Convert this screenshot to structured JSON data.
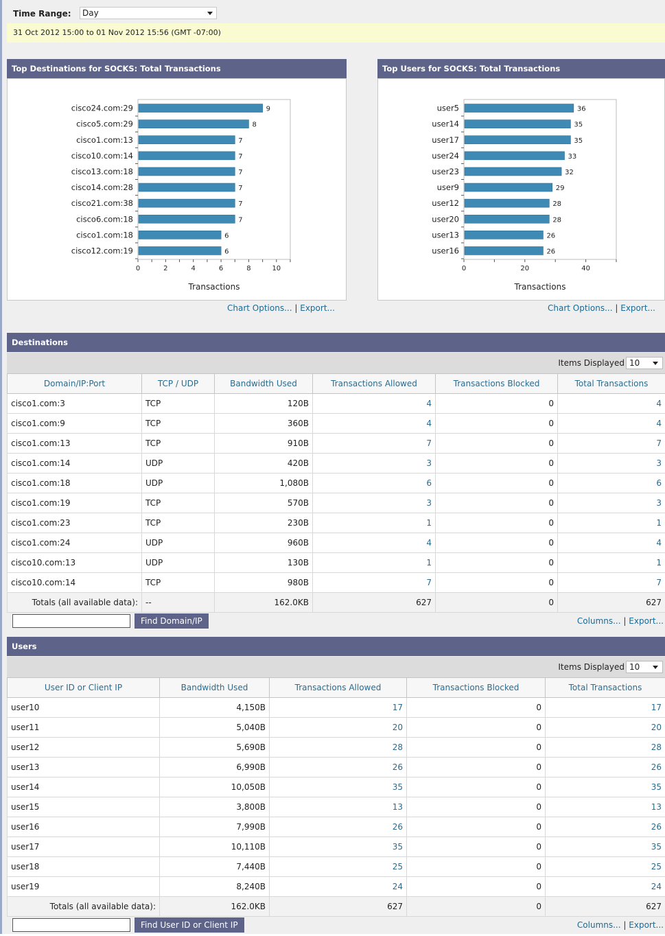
{
  "time_range": {
    "label": "Time Range:",
    "value": "Day"
  },
  "date_range": "31 Oct 2012 15:00 to 01 Nov 2012 15:56 (GMT -07:00)",
  "chart_links": {
    "options": "Chart Options...",
    "sep": "|",
    "export": "Export..."
  },
  "chart_data": [
    {
      "type": "bar",
      "orientation": "horizontal",
      "title": "Top Destinations for SOCKS: Total Transactions",
      "categories": [
        "cisco24.com:29",
        "cisco5.com:29",
        "cisco1.com:13",
        "cisco10.com:14",
        "cisco13.com:18",
        "cisco14.com:28",
        "cisco21.com:38",
        "cisco6.com:18",
        "cisco1.com:18",
        "cisco12.com:19"
      ],
      "values": [
        9,
        8,
        7,
        7,
        7,
        7,
        7,
        7,
        6,
        6
      ],
      "xlabel": "Transactions",
      "xlim": [
        0,
        11
      ],
      "xticks": [
        0,
        2,
        4,
        6,
        8,
        10
      ],
      "bar_color": "#3f8ab5",
      "data_labels": true,
      "grid": false
    },
    {
      "type": "bar",
      "orientation": "horizontal",
      "title": "Top Users for SOCKS: Total Transactions",
      "categories": [
        "user5",
        "user14",
        "user17",
        "user24",
        "user23",
        "user9",
        "user12",
        "user20",
        "user13",
        "user16"
      ],
      "values": [
        36,
        35,
        35,
        33,
        32,
        29,
        28,
        28,
        26,
        26
      ],
      "xlabel": "Transactions",
      "xlim": [
        0,
        50
      ],
      "xticks": [
        0,
        20,
        40
      ],
      "bar_color": "#3f8ab5",
      "data_labels": true,
      "grid": false
    }
  ],
  "destinations": {
    "title": "Destinations",
    "items_label": "Items Displayed",
    "items_value": "10",
    "columns": [
      "Domain/IP:Port",
      "TCP / UDP",
      "Bandwidth Used",
      "Transactions Allowed",
      "Transactions Blocked",
      "Total Transactions"
    ],
    "rows": [
      [
        "cisco1.com:3",
        "TCP",
        "120B",
        "4",
        "0",
        "4"
      ],
      [
        "cisco1.com:9",
        "TCP",
        "360B",
        "4",
        "0",
        "4"
      ],
      [
        "cisco1.com:13",
        "TCP",
        "910B",
        "7",
        "0",
        "7"
      ],
      [
        "cisco1.com:14",
        "UDP",
        "420B",
        "3",
        "0",
        "3"
      ],
      [
        "cisco1.com:18",
        "UDP",
        "1,080B",
        "6",
        "0",
        "6"
      ],
      [
        "cisco1.com:19",
        "TCP",
        "570B",
        "3",
        "0",
        "3"
      ],
      [
        "cisco1.com:23",
        "TCP",
        "230B",
        "1",
        "0",
        "1"
      ],
      [
        "cisco1.com:24",
        "UDP",
        "960B",
        "4",
        "0",
        "4"
      ],
      [
        "cisco10.com:13",
        "UDP",
        "130B",
        "1",
        "0",
        "1"
      ],
      [
        "cisco10.com:14",
        "TCP",
        "980B",
        "7",
        "0",
        "7"
      ]
    ],
    "totals": [
      "Totals (all available data):",
      "--",
      "162.0KB",
      "627",
      "0",
      "627"
    ],
    "find_button": "Find Domain/IP",
    "links": {
      "columns": "Columns...",
      "sep": "|",
      "export": "Export..."
    }
  },
  "users": {
    "title": "Users",
    "items_label": "Items Displayed",
    "items_value": "10",
    "columns": [
      "User ID or Client IP",
      "Bandwidth Used",
      "Transactions Allowed",
      "Transactions Blocked",
      "Total Transactions"
    ],
    "rows": [
      [
        "user10",
        "4,150B",
        "17",
        "0",
        "17"
      ],
      [
        "user11",
        "5,040B",
        "20",
        "0",
        "20"
      ],
      [
        "user12",
        "5,690B",
        "28",
        "0",
        "28"
      ],
      [
        "user13",
        "6,990B",
        "26",
        "0",
        "26"
      ],
      [
        "user14",
        "10,050B",
        "35",
        "0",
        "35"
      ],
      [
        "user15",
        "3,800B",
        "13",
        "0",
        "13"
      ],
      [
        "user16",
        "7,990B",
        "26",
        "0",
        "26"
      ],
      [
        "user17",
        "10,110B",
        "35",
        "0",
        "35"
      ],
      [
        "user18",
        "7,440B",
        "25",
        "0",
        "25"
      ],
      [
        "user19",
        "8,240B",
        "24",
        "0",
        "24"
      ]
    ],
    "totals": [
      "Totals (all available data):",
      "162.0KB",
      "627",
      "0",
      "627"
    ],
    "find_button": "Find User ID or Client IP",
    "links": {
      "columns": "Columns...",
      "sep": "|",
      "export": "Export..."
    }
  }
}
